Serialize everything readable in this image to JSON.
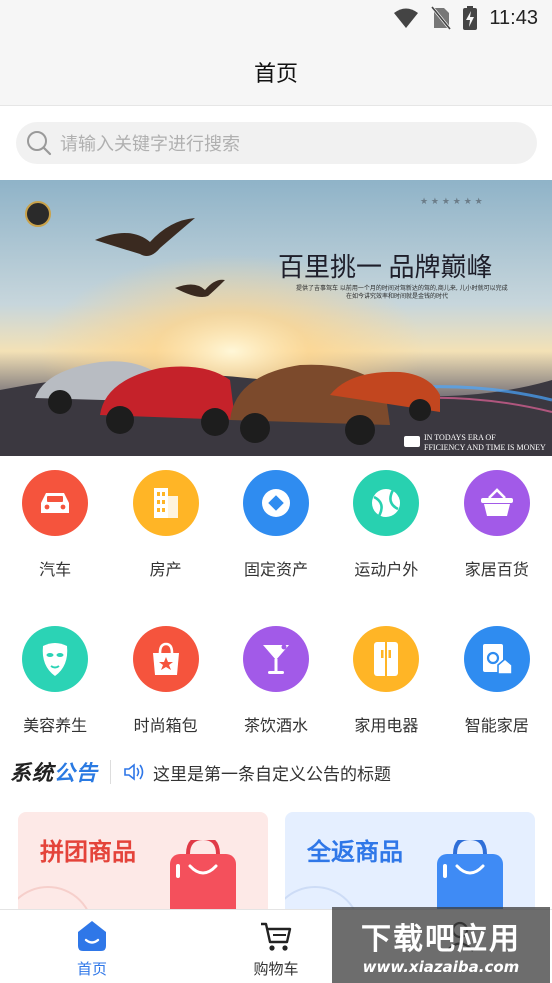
{
  "status_bar": {
    "time": "11:43"
  },
  "header": {
    "title": "首页"
  },
  "search": {
    "placeholder": "请输入关键字进行搜索"
  },
  "banner": {
    "headline": "百里挑一 品牌巅峰",
    "subline1": "提供了吉事驾车  以前用一个月的时间对驾新达的驾的,商儿来, 儿小时就可以完成",
    "subline2": "在如今讲究效率和时间就是金钱的时代",
    "tagline1": "IN TODAYS ERA OF",
    "tagline2": "FFICIENCY AND TIME IS MONEY",
    "stars": "★ ★ ★ ★ ★ ★"
  },
  "categories_row1": [
    {
      "label": "汽车",
      "color": "#f5543d",
      "icon": "car-icon"
    },
    {
      "label": "房产",
      "color": "#ffb526",
      "icon": "building-icon"
    },
    {
      "label": "固定资产",
      "color": "#2f8cf0",
      "icon": "diamond-icon"
    },
    {
      "label": "运动户外",
      "color": "#28d1b0",
      "icon": "ball-icon"
    },
    {
      "label": "家居百货",
      "color": "#a25ae8",
      "icon": "basket-icon"
    }
  ],
  "categories_row2": [
    {
      "label": "美容养生",
      "color": "#2bd3b5",
      "icon": "mask-icon"
    },
    {
      "label": "时尚箱包",
      "color": "#f5543d",
      "icon": "bag-icon"
    },
    {
      "label": "茶饮酒水",
      "color": "#a25ae8",
      "icon": "cocktail-icon"
    },
    {
      "label": "家用电器",
      "color": "#ffb526",
      "icon": "fridge-icon"
    },
    {
      "label": "智能家居",
      "color": "#2f8cf0",
      "icon": "smart-home-icon"
    }
  ],
  "notice": {
    "brand_part1": "系统",
    "brand_part2": "公告",
    "text": "这里是第一条自定义公告的标题"
  },
  "promos": [
    {
      "title": "拼团商品",
      "color": "#e4433a"
    },
    {
      "title": "全返商品",
      "color": "#2f77e8"
    }
  ],
  "bottom_nav": [
    {
      "label": "首页",
      "active": true
    },
    {
      "label": "购物车",
      "active": false
    },
    {
      "label": "",
      "active": false
    }
  ],
  "watermark": {
    "title": "下载吧应用",
    "url": "www.xiazaiba.com"
  }
}
